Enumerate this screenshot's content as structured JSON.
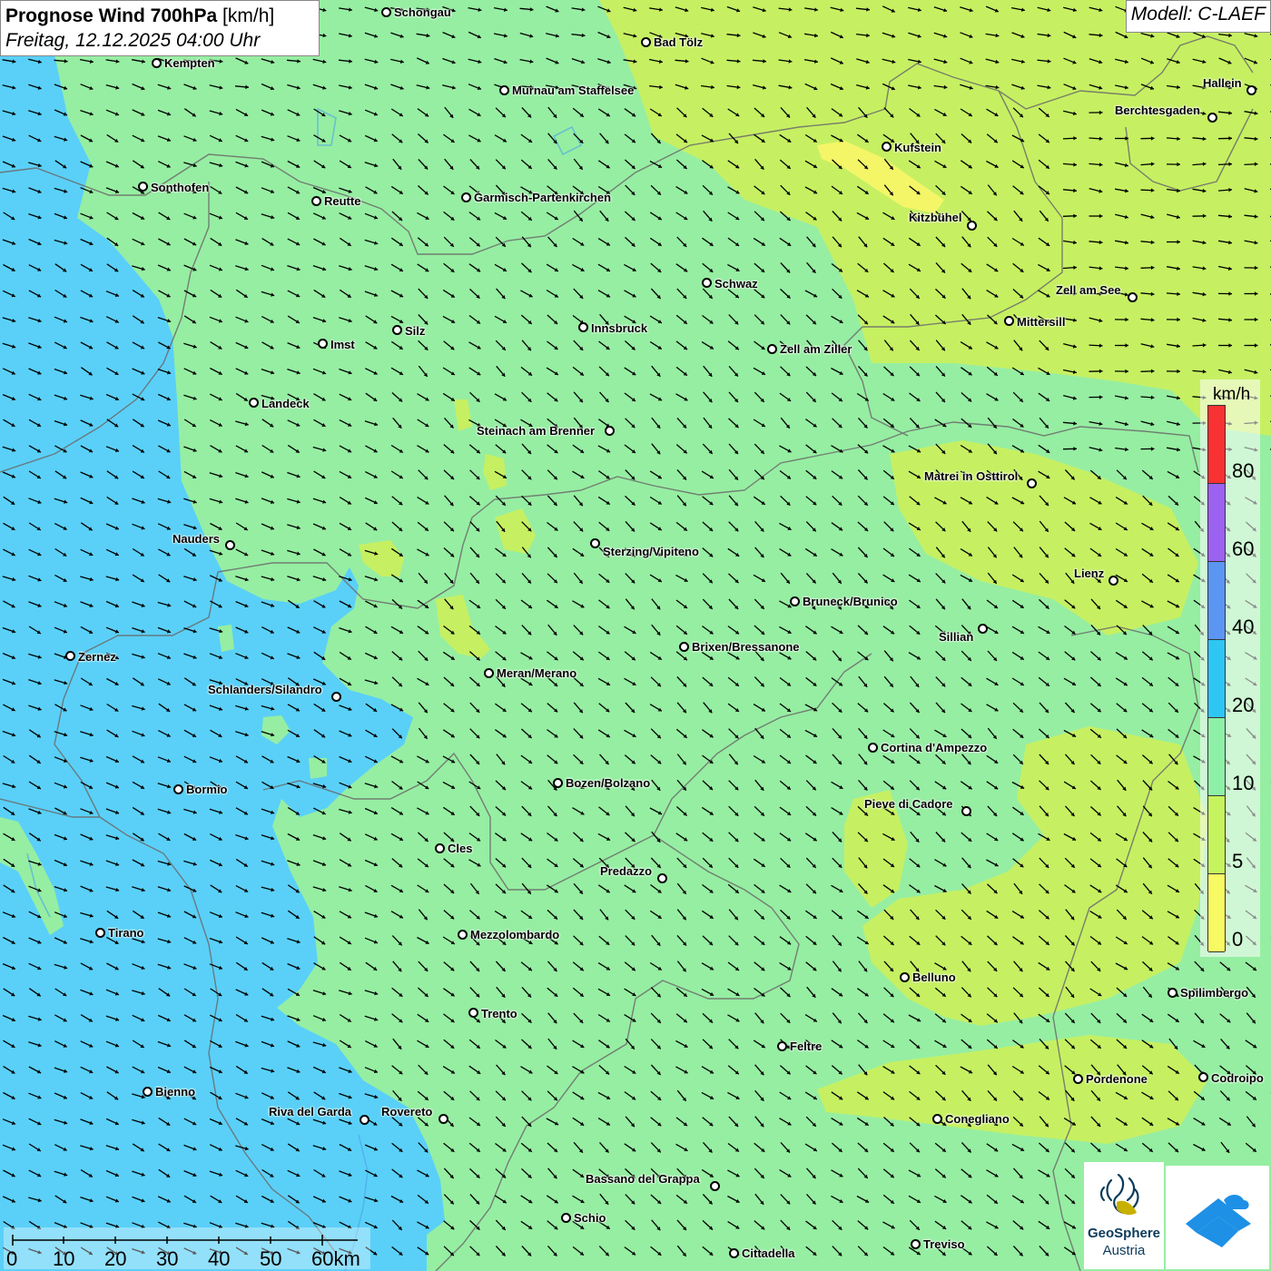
{
  "header": {
    "title_bold": "Prognose Wind 700hPa",
    "title_unit": "[km/h]",
    "datetime": "Freitag, 12.12.2025 04:00 Uhr",
    "model": "Modell: C-LAEF"
  },
  "legend": {
    "unit": "km/h",
    "ticks": [
      "80",
      "60",
      "40",
      "20",
      "10",
      "5",
      "0"
    ],
    "colors": [
      "#f83232",
      "#9c62f0",
      "#5a96f2",
      "#2ec6f2",
      "#8ef0a6",
      "#c6f45e",
      "#f8fa64"
    ]
  },
  "scale_bar": {
    "ticks": [
      "0",
      "10",
      "20",
      "30",
      "40",
      "50",
      "60km"
    ]
  },
  "logos": {
    "geosphere_line1": "GeoSphere",
    "geosphere_line2": "Austria",
    "geosphere_icon": "geosphere-logo-icon",
    "partner_icon": "partner-logo-icon"
  },
  "field_colors": {
    "calm": "#f4f668",
    "light": "#c6f062",
    "moderate": "#96eea2",
    "strong": "#5ad0f8"
  },
  "cities": [
    {
      "name": "Schongau",
      "dot": [
        425,
        13
      ],
      "label": [
        434,
        6
      ]
    },
    {
      "name": "Bad Tölz",
      "dot": [
        711,
        46
      ],
      "label": [
        720,
        39
      ]
    },
    {
      "name": "Kempten",
      "dot": [
        172,
        69
      ],
      "label": [
        181,
        62
      ]
    },
    {
      "name": "Murnau am Staffelsee",
      "dot": [
        555,
        99
      ],
      "label": [
        564,
        92
      ]
    },
    {
      "name": "Hallein",
      "dot": [
        1378,
        99
      ],
      "label": [
        1325,
        84
      ]
    },
    {
      "name": "Berchtesgaden",
      "dot": [
        1335,
        129
      ],
      "label": [
        1228,
        114
      ]
    },
    {
      "name": "Kufstein",
      "dot": [
        976,
        161
      ],
      "label": [
        985,
        155
      ]
    },
    {
      "name": "Sonthofen",
      "dot": [
        157,
        205
      ],
      "label": [
        166,
        199
      ]
    },
    {
      "name": "Reutte",
      "dot": [
        348,
        221
      ],
      "label": [
        357,
        214
      ]
    },
    {
      "name": "Garmisch-Partenkirchen",
      "dot": [
        513,
        217
      ],
      "label": [
        522,
        210
      ]
    },
    {
      "name": "Kitzbühel",
      "dot": [
        1070,
        248
      ],
      "label": [
        1001,
        232
      ]
    },
    {
      "name": "Schwaz",
      "dot": [
        778,
        311
      ],
      "label": [
        787,
        305
      ]
    },
    {
      "name": "Zell am See",
      "dot": [
        1247,
        327
      ],
      "label": [
        1163,
        312
      ]
    },
    {
      "name": "Mittersill",
      "dot": [
        1111,
        353
      ],
      "label": [
        1120,
        347
      ]
    },
    {
      "name": "Innsbruck",
      "dot": [
        642,
        360
      ],
      "label": [
        651,
        354
      ]
    },
    {
      "name": "Silz",
      "dot": [
        437,
        363
      ],
      "label": [
        446,
        357
      ]
    },
    {
      "name": "Imst",
      "dot": [
        355,
        378
      ],
      "label": [
        364,
        372
      ]
    },
    {
      "name": "Zell am Ziller",
      "dot": [
        850,
        384
      ],
      "label": [
        859,
        377
      ]
    },
    {
      "name": "Landeck",
      "dot": [
        279,
        443
      ],
      "label": [
        288,
        437
      ]
    },
    {
      "name": "Steinach am Brenner",
      "dot": [
        671,
        474
      ],
      "label": [
        525,
        467
      ]
    },
    {
      "name": "Matrei in Osttirol",
      "dot": [
        1136,
        532
      ],
      "label": [
        1018,
        517
      ]
    },
    {
      "name": "Nauders",
      "dot": [
        253,
        600
      ],
      "label": [
        190,
        586
      ]
    },
    {
      "name": "Sterzing/Vipiteno",
      "dot": [
        655,
        598
      ],
      "label": [
        664,
        600
      ]
    },
    {
      "name": "Lienz",
      "dot": [
        1226,
        639
      ],
      "label": [
        1183,
        624
      ]
    },
    {
      "name": "Bruneck/Brunico",
      "dot": [
        875,
        662
      ],
      "label": [
        884,
        655
      ]
    },
    {
      "name": "Sillian",
      "dot": [
        1082,
        692
      ],
      "label": [
        1034,
        694
      ]
    },
    {
      "name": "Brixen/Bressanone",
      "dot": [
        753,
        712
      ],
      "label": [
        762,
        705
      ]
    },
    {
      "name": "Zernez",
      "dot": [
        77,
        722
      ],
      "label": [
        86,
        716
      ]
    },
    {
      "name": "Meran/Merano",
      "dot": [
        538,
        741
      ],
      "label": [
        547,
        734
      ]
    },
    {
      "name": "Schlanders/Silandro",
      "dot": [
        370,
        767
      ],
      "label": [
        229,
        752
      ]
    },
    {
      "name": "Cortina d'Ampezzo",
      "dot": [
        961,
        823
      ],
      "label": [
        970,
        816
      ]
    },
    {
      "name": "Bozen/Bolzano",
      "dot": [
        614,
        862
      ],
      "label": [
        623,
        855
      ]
    },
    {
      "name": "Bormio",
      "dot": [
        196,
        869
      ],
      "label": [
        205,
        862
      ]
    },
    {
      "name": "Pieve di Cadore",
      "dot": [
        1064,
        893
      ],
      "label": [
        952,
        878
      ]
    },
    {
      "name": "Cles",
      "dot": [
        484,
        934
      ],
      "label": [
        493,
        927
      ]
    },
    {
      "name": "Predazzo",
      "dot": [
        729,
        967
      ],
      "label": [
        661,
        952
      ]
    },
    {
      "name": "Tirano",
      "dot": [
        110,
        1027
      ],
      "label": [
        119,
        1020
      ]
    },
    {
      "name": "Mezzolombardo",
      "dot": [
        509,
        1029
      ],
      "label": [
        518,
        1022
      ]
    },
    {
      "name": "Belluno",
      "dot": [
        996,
        1076
      ],
      "label": [
        1005,
        1069
      ]
    },
    {
      "name": "Spilimbergo",
      "dot": [
        1291,
        1093
      ],
      "label": [
        1300,
        1086
      ]
    },
    {
      "name": "Trento",
      "dot": [
        521,
        1115
      ],
      "label": [
        530,
        1109
      ]
    },
    {
      "name": "Feltre",
      "dot": [
        861,
        1152
      ],
      "label": [
        870,
        1145
      ]
    },
    {
      "name": "Pordenone",
      "dot": [
        1187,
        1188
      ],
      "label": [
        1196,
        1181
      ]
    },
    {
      "name": "Codroipo",
      "dot": [
        1325,
        1186
      ],
      "label": [
        1334,
        1180
      ]
    },
    {
      "name": "Bienno",
      "dot": [
        162,
        1202
      ],
      "label": [
        171,
        1195
      ]
    },
    {
      "name": "Riva del Garda",
      "dot": [
        401,
        1233
      ],
      "label": [
        296,
        1217
      ]
    },
    {
      "name": "Rovereto",
      "dot": [
        488,
        1232
      ],
      "label": [
        420,
        1217
      ]
    },
    {
      "name": "Conegliano",
      "dot": [
        1032,
        1232
      ],
      "label": [
        1041,
        1225
      ]
    },
    {
      "name": "Bassano del Grappa",
      "dot": [
        787,
        1306
      ],
      "label": [
        645,
        1291
      ]
    },
    {
      "name": "Schio",
      "dot": [
        623,
        1341
      ],
      "label": [
        632,
        1334
      ]
    },
    {
      "name": "Treviso",
      "dot": [
        1008,
        1370
      ],
      "label": [
        1017,
        1363
      ]
    },
    {
      "name": "Cittadella",
      "dot": [
        808,
        1380
      ],
      "label": [
        817,
        1373
      ]
    }
  ]
}
